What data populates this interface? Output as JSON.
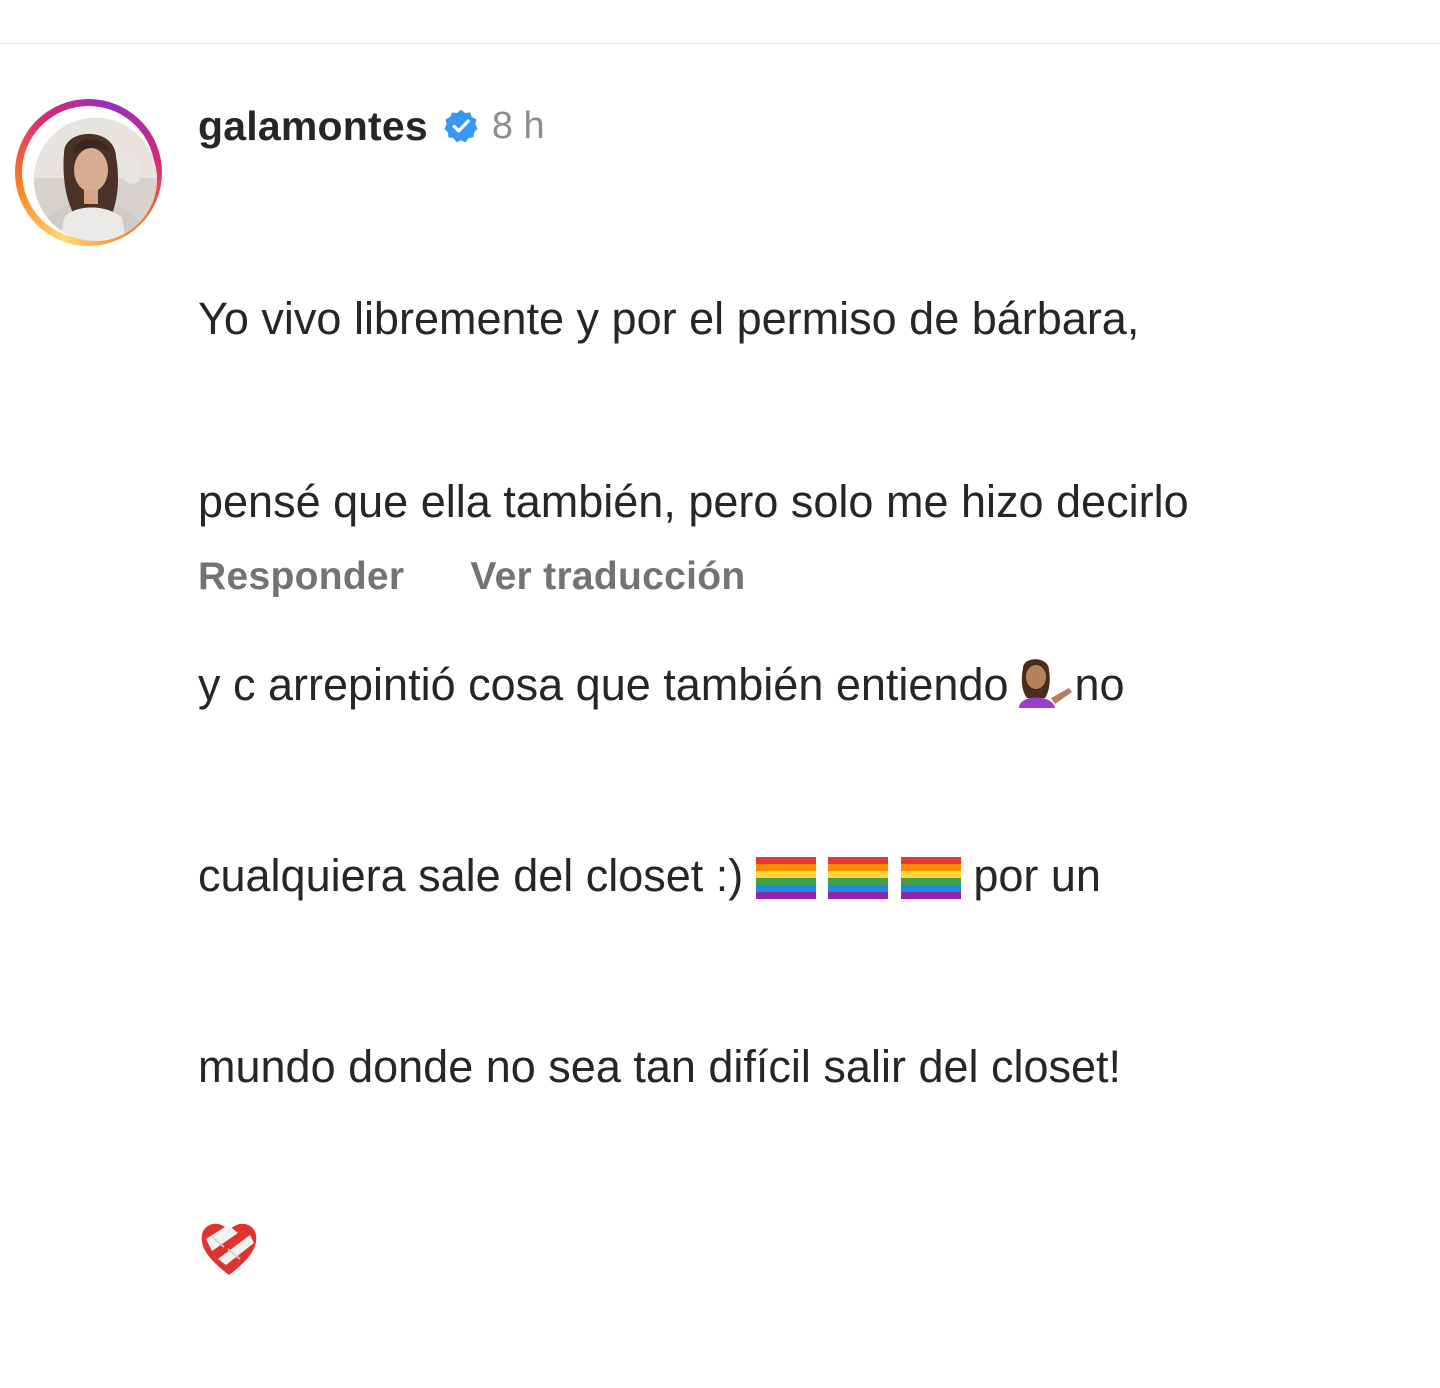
{
  "comment": {
    "username": "galamontes",
    "verified": true,
    "time": "8 h",
    "text_lines": [
      "Yo vivo libremente y por el permiso de bárbara,",
      "pensé que ella también, pero solo me hizo decirlo",
      "y c arrepintió cosa que también entiendo",
      "no",
      "cualquiera sale del closet :)",
      "por un",
      "mundo donde no sea tan difícil salir del closet!"
    ],
    "emojis": {
      "person_tipping_hand": "person-tipping-hand-icon",
      "rainbow_flag": "rainbow-flag-icon",
      "mending_heart": "mending-heart-icon"
    },
    "actions": {
      "reply": "Responder",
      "translate": "Ver traducción"
    }
  },
  "colors": {
    "username": "#262626",
    "meta": "#8e8e8e",
    "action": "#737373",
    "verified_blue": "#3897f0"
  }
}
